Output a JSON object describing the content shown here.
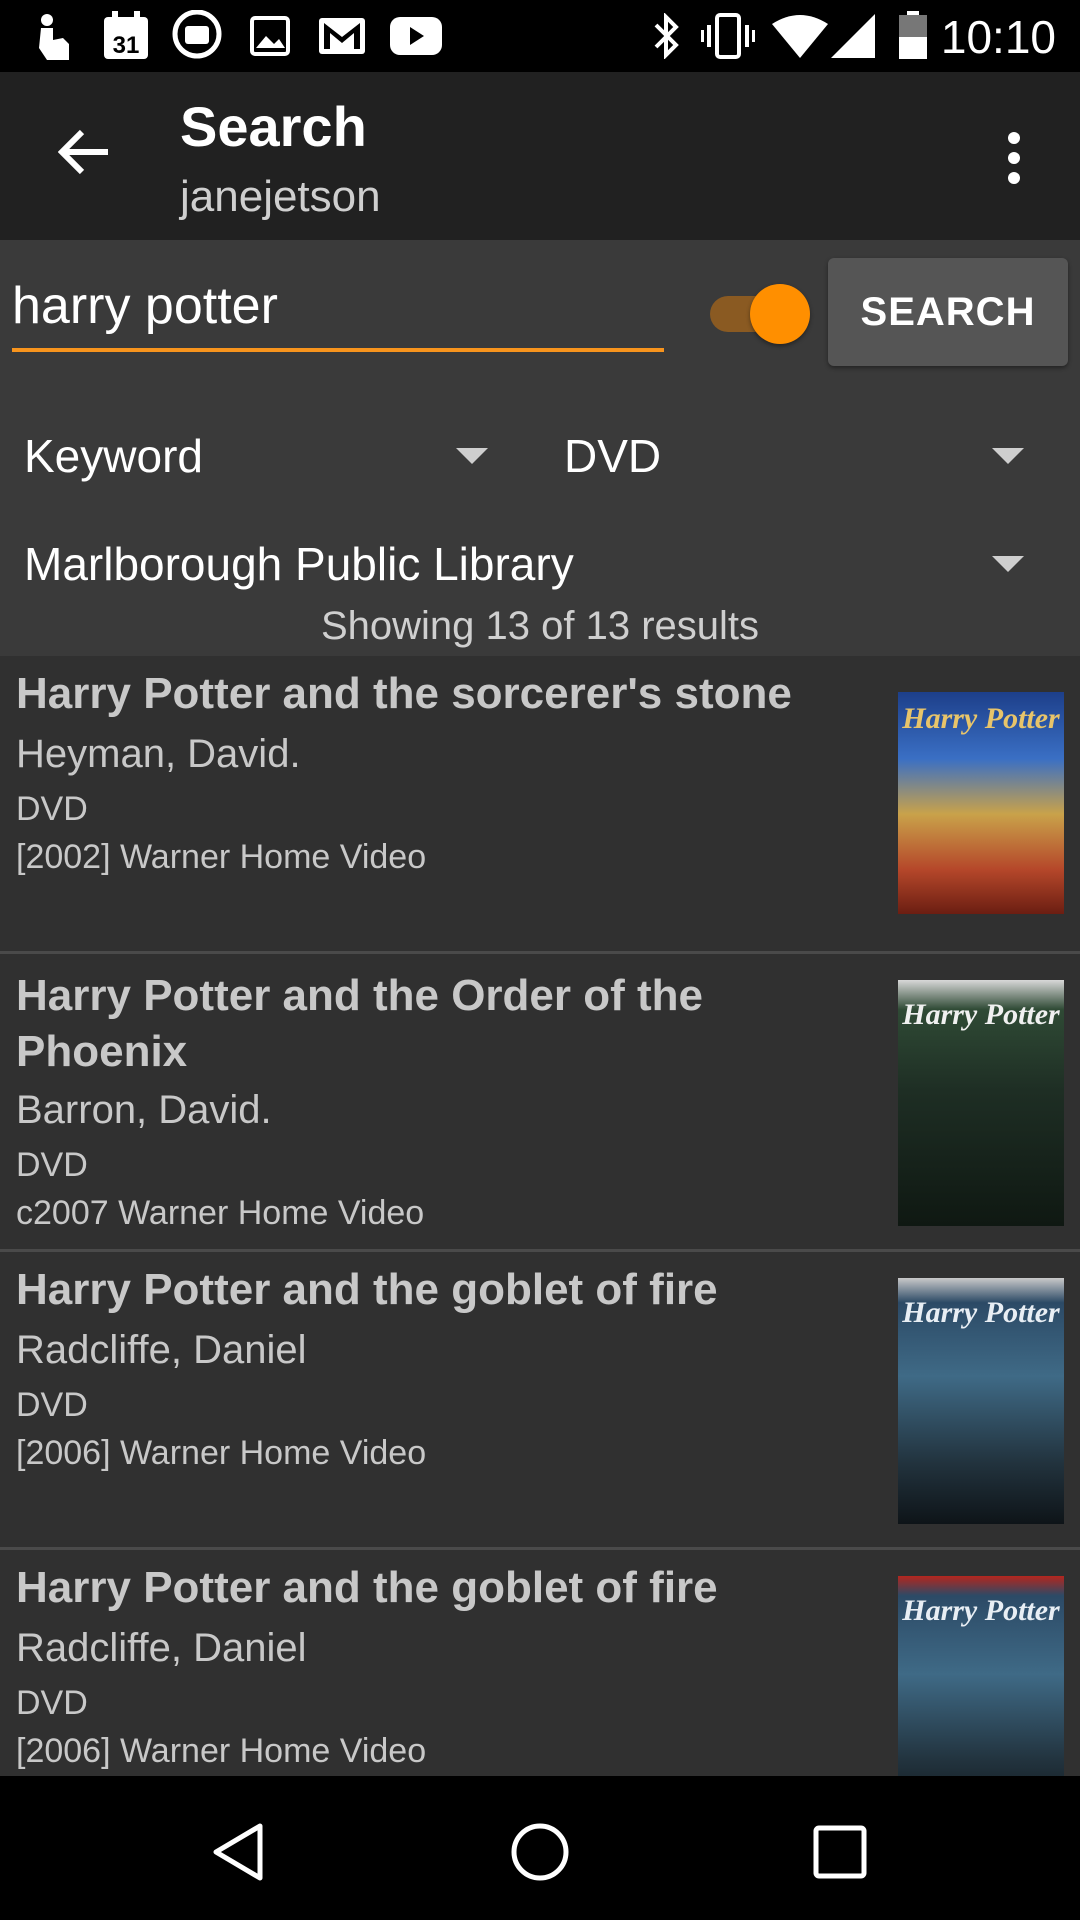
{
  "status_bar": {
    "time": "10:10",
    "left_icons": [
      "touch-icon",
      "calendar-icon",
      "hangouts-icon",
      "photos-icon",
      "gmail-icon",
      "youtube-icon"
    ],
    "calendar_day": "31",
    "right_icons": [
      "bluetooth-icon",
      "vibrate-icon",
      "wifi-icon",
      "signal-icon",
      "battery-icon"
    ]
  },
  "toolbar": {
    "title": "Search",
    "subtitle": "janejetson"
  },
  "search": {
    "query": "harry potter",
    "toggle_on": true,
    "button_label": "SEARCH",
    "accent_color": "#f7941d",
    "search_type": "Keyword",
    "format": "DVD",
    "library": "Marlborough Public Library",
    "results_text": "Showing 13 of 13 results"
  },
  "results": [
    {
      "title": "Harry Potter and the sorcerer's stone",
      "author": "Heyman, David.",
      "format": "DVD",
      "publication": "[2002] Warner Home Video",
      "cover_brand": "Harry Potter"
    },
    {
      "title": "Harry Potter and the Order of the Phoenix",
      "author": "Barron, David.",
      "format": "DVD",
      "publication": "c2007 Warner Home Video",
      "cover_brand": "Harry Potter"
    },
    {
      "title": "Harry Potter and the goblet of fire",
      "author": "Radcliffe, Daniel",
      "format": "DVD",
      "publication": "[2006] Warner Home Video",
      "cover_brand": "Harry Potter"
    },
    {
      "title": "Harry Potter and the goblet of fire",
      "author": "Radcliffe, Daniel",
      "format": "DVD",
      "publication": "[2006] Warner Home Video",
      "cover_brand": "Harry Potter"
    }
  ],
  "navbar": {
    "icons": [
      "back-triangle-icon",
      "home-circle-icon",
      "recents-square-icon"
    ]
  }
}
